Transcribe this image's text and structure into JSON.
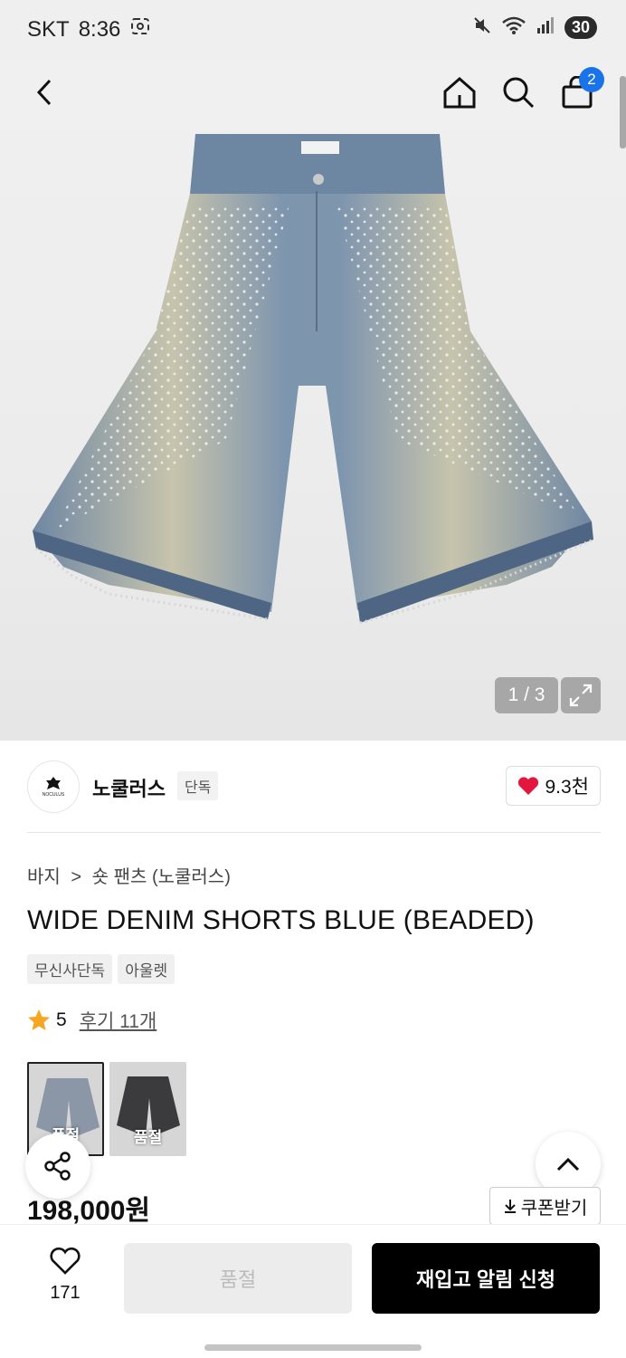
{
  "status_bar": {
    "carrier": "SKT",
    "time": "8:36",
    "battery": "30"
  },
  "nav": {
    "cart_count": "2"
  },
  "gallery": {
    "page_indicator": "1 / 3"
  },
  "brand": {
    "logo_text": "NOCULUS",
    "name": "노쿨러스",
    "tag": "단독",
    "likes": "9.3천"
  },
  "breadcrumb": {
    "category": "바지",
    "separator": ">",
    "subcategory": "숏 팬츠 (노쿨러스)"
  },
  "product": {
    "title": "WIDE DENIM SHORTS BLUE (BEADED)",
    "tags": [
      "무신사단독",
      "아울렛"
    ],
    "rating": "5",
    "reviews": "후기 11개",
    "price": "198,000원"
  },
  "swatches": [
    {
      "label": "품절",
      "color": "#8b97a6"
    },
    {
      "label": "품절",
      "color": "#3b3b3d"
    }
  ],
  "actions": {
    "coupon": "쿠폰받기",
    "wish_count": "171",
    "soldout": "품절",
    "restock": "재입고 알림 신청"
  },
  "colors": {
    "accent": "#1a73e8",
    "heart": "#e3173d",
    "star": "#f5a623"
  }
}
